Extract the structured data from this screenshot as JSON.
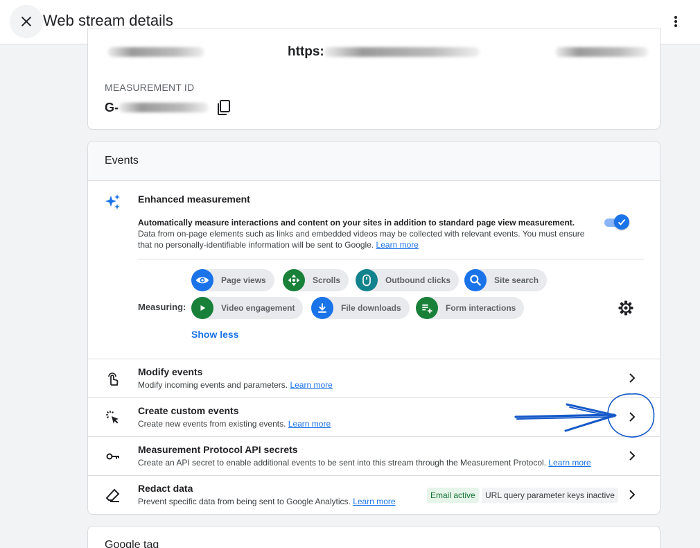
{
  "header": {
    "title": "Web stream details"
  },
  "stream": {
    "url_prefix": "https:",
    "measurement_id_label": "MEASUREMENT ID",
    "measurement_id_prefix": "G-"
  },
  "events": {
    "section_title": "Events",
    "enhanced": {
      "title": "Enhanced measurement",
      "desc_bold": "Automatically measure interactions and content on your sites in addition to standard page view measurement.",
      "desc_rest": "Data from on-page elements such as links and embedded videos may be collected with relevant events. You must ensure that no personally-identifiable information will be sent to Google.",
      "learn_more": "Learn more",
      "enabled": true
    },
    "measuring_label": "Measuring:",
    "chips": [
      {
        "label": "Page views",
        "icon": "eye-icon",
        "color": "#1a73e8"
      },
      {
        "label": "Scrolls",
        "icon": "scroll-arrows-icon",
        "color": "#188038"
      },
      {
        "label": "Outbound clicks",
        "icon": "mouse-icon",
        "color": "#12838c"
      },
      {
        "label": "Site search",
        "icon": "search-icon",
        "color": "#1a73e8"
      },
      {
        "label": "Video engagement",
        "icon": "play-icon",
        "color": "#188038"
      },
      {
        "label": "File downloads",
        "icon": "download-icon",
        "color": "#1a73e8"
      },
      {
        "label": "Form interactions",
        "icon": "playlist-add-icon",
        "color": "#188038"
      }
    ],
    "show_less": "Show less",
    "rows": [
      {
        "title": "Modify events",
        "desc": "Modify incoming events and parameters.",
        "learn_more": "Learn more",
        "icon": "touch-icon"
      },
      {
        "title": "Create custom events",
        "desc": "Create new events from existing events.",
        "learn_more": "Learn more",
        "icon": "cursor-click-icon"
      },
      {
        "title": "Measurement Protocol API secrets",
        "desc": "Create an API secret to enable additional events to be sent into this stream through the Measurement Protocol.",
        "learn_more": "Learn more",
        "icon": "key-icon"
      },
      {
        "title": "Redact data",
        "desc": "Prevent specific data from being sent to Google Analytics.",
        "learn_more": "Learn more",
        "icon": "eraser-icon"
      }
    ],
    "redact_badges": {
      "email": "Email active",
      "url_query": "URL query parameter keys inactive"
    }
  },
  "google_tag": {
    "title": "Google tag"
  },
  "colors": {
    "accent": "#1a73e8",
    "annotation": "#1559c9"
  }
}
